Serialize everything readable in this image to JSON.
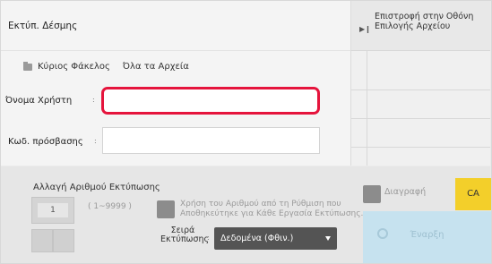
{
  "header": {
    "title": "Εκτύπ. Δέσμης"
  },
  "folders": {
    "main_folder": "Κύριος Φάκελος",
    "all_files": "Όλα τα Αρχεία"
  },
  "form": {
    "username_label": "Όνομα Χρήστη",
    "username_colon": ":",
    "username_value": "",
    "password_label": "Κωδ. πρόσβασης",
    "password_colon": ":",
    "password_value": ""
  },
  "side": {
    "return_button": "Επιστροφή στην Οθόνη Επιλογής Αρχείου"
  },
  "print_count": {
    "title": "Αλλαγή Αριθμού Εκτύπωσης",
    "value": "1",
    "range": "( 1~9999 )",
    "use_saved_text": "Χρήση του Αριθμού από τη Ρύθμιση που Αποθηκεύτηκε για Κάθε Εργασία Εκτύπωσης."
  },
  "print_order": {
    "label": "Σειρά Εκτύπωσης",
    "colon": ":",
    "selected": "Δεδομένα (Φθιν.)"
  },
  "actions": {
    "delete": "Διαγραφή",
    "ca": "CA",
    "start": "Έναρξη"
  },
  "colors": {
    "focus_border": "#e5143c",
    "ca_button": "#f3cf2a",
    "start_button": "#c6e2ef",
    "select_bg": "#545454"
  },
  "icons": {
    "folder": "folder-icon",
    "return": "play-right-icon",
    "start": "start-circle-icon"
  }
}
